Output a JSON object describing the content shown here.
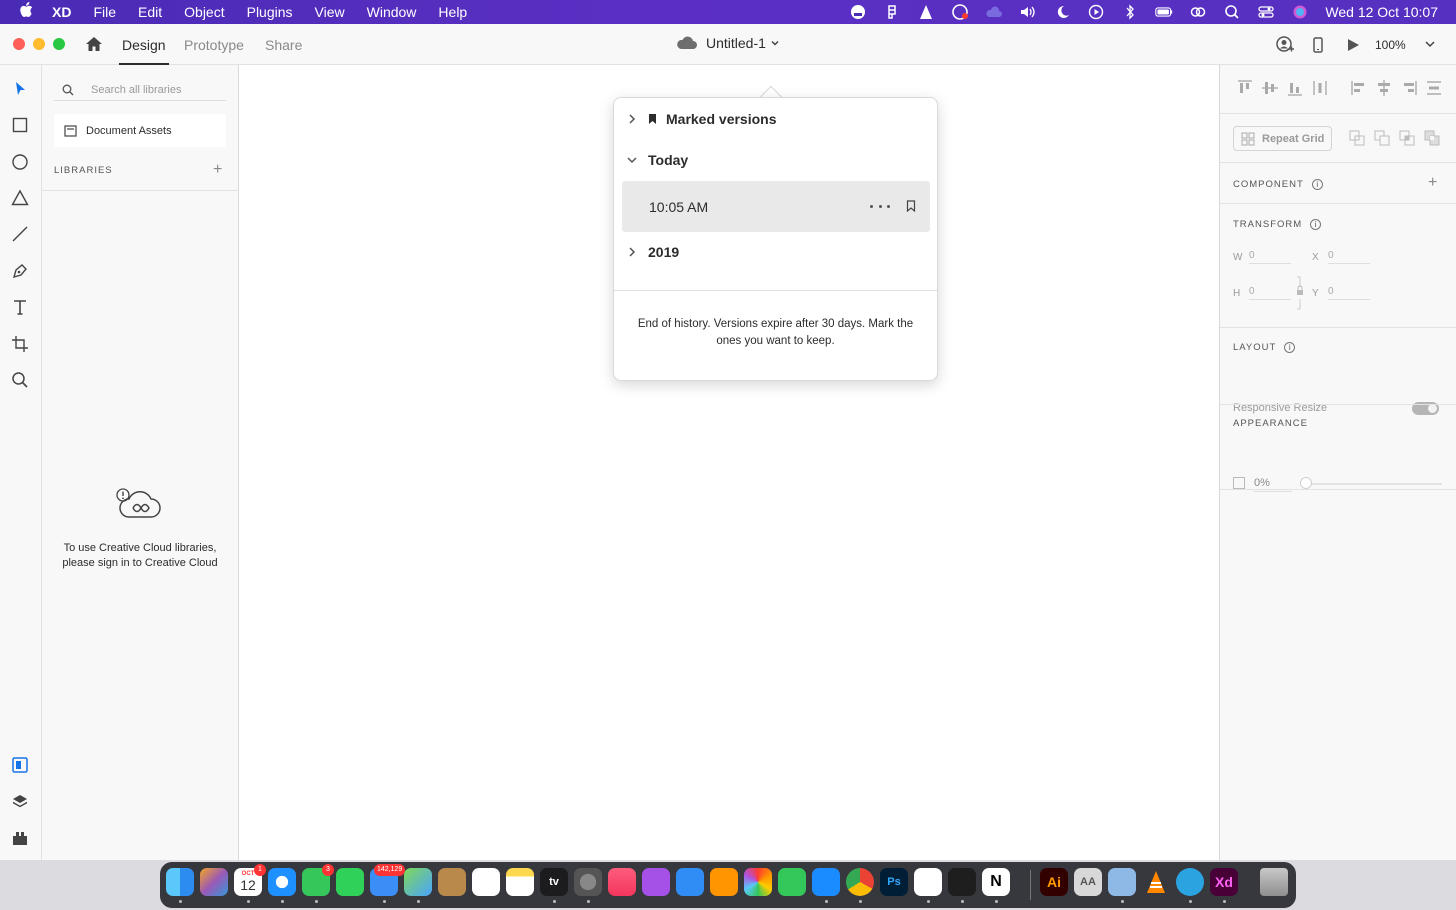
{
  "menubar": {
    "app_name": "XD",
    "menus": [
      "File",
      "Edit",
      "Object",
      "Plugins",
      "View",
      "Window",
      "Help"
    ],
    "clock": "Wed 12 Oct  10:07",
    "status_icons": [
      "istat-icon",
      "figma-icon",
      "vlc-icon",
      "creative-cloud-icon",
      "cloud-icon",
      "volume-icon",
      "moon-icon",
      "play-icon",
      "bluetooth-icon",
      "battery-icon",
      "link-icon",
      "search-icon",
      "control-center-icon",
      "siri-icon"
    ]
  },
  "titlebar": {
    "tabs": {
      "design": "Design",
      "prototype": "Prototype",
      "share": "Share"
    },
    "document_title": "Untitled-1",
    "zoom": "100%"
  },
  "libraries": {
    "search_placeholder": "Search all libraries",
    "document_assets": "Document Assets",
    "header": "LIBRARIES",
    "add": "+",
    "message": "To use Creative Cloud libraries, please sign in to Creative Cloud"
  },
  "version_history": {
    "marked_versions": "Marked versions",
    "today": "Today",
    "version_time": "10:05 AM",
    "year": "2019",
    "footer": "End of history. Versions expire after 30 days. Mark the ones you want to keep."
  },
  "inspector": {
    "repeat_grid": "Repeat Grid",
    "component": "COMPONENT",
    "component_add": "+",
    "transform": "TRANSFORM",
    "w_label": "W",
    "w_value": "0",
    "x_label": "X",
    "x_value": "0",
    "h_label": "H",
    "h_value": "0",
    "y_label": "Y",
    "y_value": "0",
    "layout": "LAYOUT",
    "responsive_resize": "Responsive Resize",
    "appearance": "APPEARANCE",
    "opacity": "0%",
    "info": "i"
  },
  "dock": {
    "calendar_month": "OCT",
    "calendar_day": "12",
    "badges": {
      "calendar": "1",
      "messages": "3",
      "mail": "142,129"
    },
    "apps": [
      "Finder",
      "Launchpad",
      "Calendar",
      "Safari",
      "Messages",
      "FaceTime",
      "Mail",
      "Maps",
      "Contacts",
      "Reminders",
      "Notes",
      "TV",
      "System Preferences",
      "Music",
      "Podcasts",
      "Keynote",
      "Pages",
      "Photos",
      "Numbers",
      "App Store",
      "Chrome",
      "Photoshop",
      "Slack",
      "Figma",
      "Notion",
      "Illustrator",
      "Font Book",
      "Preview",
      "VLC",
      "Telegram",
      "XD",
      "Trash"
    ],
    "labels": {
      "tv": "tv",
      "photoshop": "Ps",
      "notion": "N",
      "illustrator": "Ai",
      "fontbook": "AA",
      "xd": "Xd"
    }
  },
  "colors": {
    "menubar": "#5630c0",
    "accent_blue": "#1473e6",
    "xd_purple": "#470137",
    "xd_pink": "#ff61f6"
  }
}
